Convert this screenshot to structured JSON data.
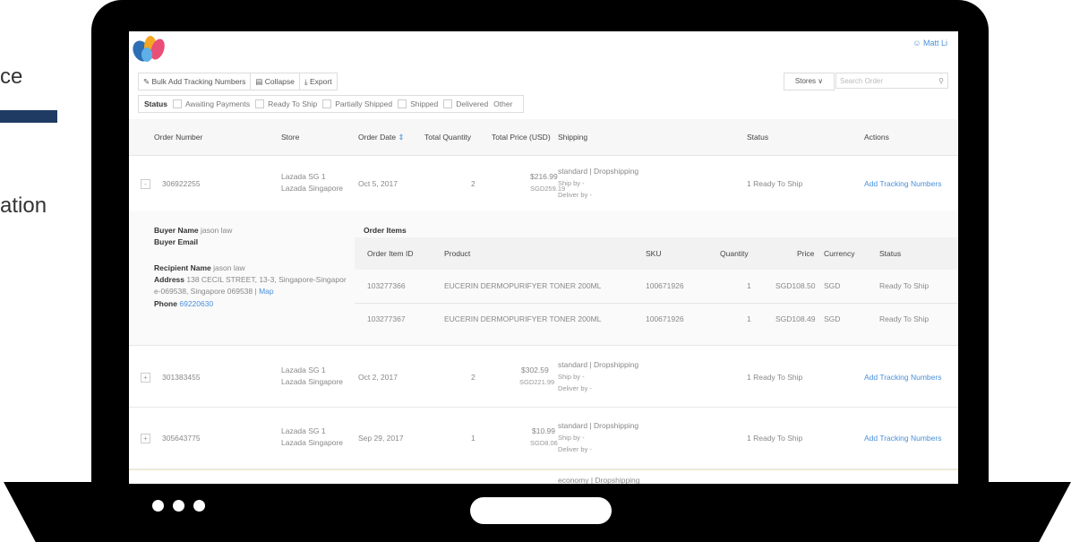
{
  "background": {
    "text1": "ce",
    "text2": "ation"
  },
  "app": {
    "user": "Matt Li",
    "toolbar": {
      "bulk_add": "Bulk Add Tracking Numbers",
      "collapse": "Collapse",
      "export": "Export"
    },
    "stores_label": "Stores",
    "search_placeholder": "Search Order",
    "filters": {
      "label": "Status",
      "options": [
        "Awaiting Payments",
        "Ready To Ship",
        "Partially Shipped",
        "Shipped",
        "Delivered"
      ],
      "other": "Other"
    },
    "columns": {
      "order_number": "Order Number",
      "store": "Store",
      "order_date": "Order Date",
      "total_quantity": "Total Quantity",
      "total_price": "Total Price (USD)",
      "shipping": "Shipping",
      "status": "Status",
      "actions": "Actions"
    },
    "orders": [
      {
        "toggle": "-",
        "number": "306922255",
        "store1": "Lazada SG 1",
        "store2": "Lazada Singapore",
        "date": "Oct 5, 2017",
        "qty": "2",
        "price": "$216.99",
        "price_sub": "SGD259.19",
        "ship1": "standard | Dropshipping",
        "ship2": "Ship by -",
        "ship3": "Deliver by -",
        "status": "1 Ready To Ship",
        "action": "Add Tracking Numbers"
      },
      {
        "toggle": "+",
        "number": "301383455",
        "store1": "Lazada SG 1",
        "store2": "Lazada Singapore",
        "date": "Oct 2, 2017",
        "qty": "2",
        "price": "$302.59",
        "price_sub": "SGD221.99",
        "ship1": "standard | Dropshipping",
        "ship2": "Ship by -",
        "ship3": "Deliver by -",
        "status": "1 Ready To Ship",
        "action": "Add Tracking Numbers"
      },
      {
        "toggle": "+",
        "number": "305643775",
        "store1": "Lazada SG 1",
        "store2": "Lazada Singapore",
        "date": "Sep 29, 2017",
        "qty": "1",
        "price": "$10.99",
        "price_sub": "SGD8.06",
        "ship1": "standard | Dropshipping",
        "ship2": "Ship by -",
        "ship3": "Deliver by -",
        "status": "1 Ready To Ship",
        "action": "Add Tracking Numbers"
      }
    ],
    "partial_row_text": "economy | Dropshipping",
    "detail": {
      "buyer_name_label": "Buyer Name",
      "buyer_name": "jason law",
      "buyer_email_label": "Buyer Email",
      "recipient_label": "Recipient Name",
      "recipient": "jason law",
      "address_label": "Address",
      "address_line1": "138 CECIL STREET, 13-3, Singapore-Singapor",
      "address_line2": "e-069538, Singapore 069538 |",
      "map": "Map",
      "phone_label": "Phone",
      "phone": "69220630",
      "order_items_title": "Order Items",
      "item_columns": {
        "id": "Order Item ID",
        "product": "Product",
        "sku": "SKU",
        "quantity": "Quantity",
        "price": "Price",
        "currency": "Currency",
        "status": "Status"
      },
      "items": [
        {
          "id": "103277366",
          "product": "EUCERIN DERMOPURIFYER TONER 200ML",
          "sku": "100671926",
          "qty": "1",
          "price": "SGD108.50",
          "currency": "SGD",
          "status": "Ready To Ship"
        },
        {
          "id": "103277367",
          "product": "EUCERIN DERMOPURIFYER TONER 200ML",
          "sku": "100671926",
          "qty": "1",
          "price": "SGD108.49",
          "currency": "SGD",
          "status": "Ready To Ship"
        }
      ]
    },
    "colors": {
      "link": "#4a90d9",
      "bar": "#1f3b64"
    }
  }
}
